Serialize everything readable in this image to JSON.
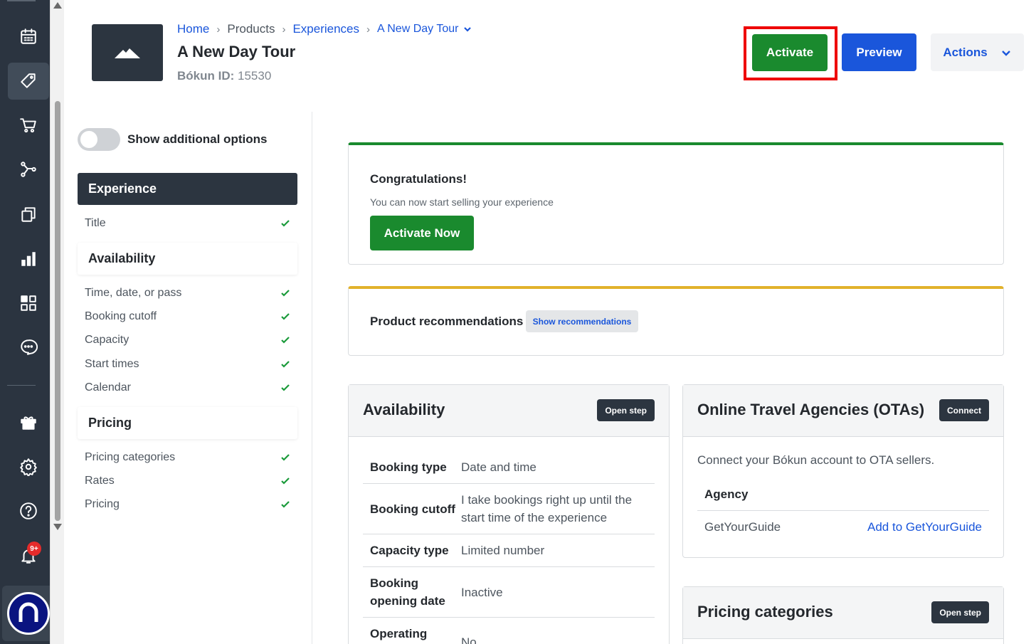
{
  "header": {
    "breadcrumb": {
      "home": "Home",
      "products": "Products",
      "experiences": "Experiences",
      "current": "A New Day Tour"
    },
    "title": "A New Day Tour",
    "bokun_id_label": "Bókun ID:",
    "bokun_id_value": "15530",
    "buttons": {
      "activate": "Activate",
      "preview": "Preview",
      "actions": "Actions"
    }
  },
  "rail": {
    "items": [
      "calendar-icon",
      "tag-icon",
      "cart-icon",
      "network-icon",
      "copy-icon",
      "bar-chart-icon",
      "widgets-icon",
      "chat-icon",
      "gift-icon",
      "gear-icon",
      "help-icon",
      "bell-icon"
    ],
    "notification_badge": "9+"
  },
  "sidenav": {
    "toggle_label": "Show additional options",
    "sections": [
      {
        "title": "Experience",
        "items": [
          "Title"
        ]
      },
      {
        "title": "Availability",
        "items": [
          "Time, date, or pass",
          "Booking cutoff",
          "Capacity",
          "Start times",
          "Calendar"
        ]
      },
      {
        "title": "Pricing",
        "items": [
          "Pricing categories",
          "Rates",
          "Pricing"
        ]
      }
    ]
  },
  "main": {
    "congrats": {
      "title": "Congratulations!",
      "subtitle": "You can now start selling your experience",
      "button": "Activate Now"
    },
    "recommendations": {
      "title": "Product recommendations",
      "button": "Show recommendations"
    },
    "availability": {
      "title": "Availability",
      "button": "Open step",
      "rows": [
        {
          "key": "Booking type",
          "value": "Date and time"
        },
        {
          "key": "Booking cutoff",
          "value": "I take bookings right up until the start time of the experience"
        },
        {
          "key": "Capacity type",
          "value": "Limited number"
        },
        {
          "key": "Booking opening date",
          "value": "Inactive"
        },
        {
          "key": "Operating",
          "value": "No"
        }
      ]
    },
    "ota": {
      "title": "Online Travel Agencies (OTAs)",
      "button": "Connect",
      "description": "Connect your Bókun account to OTA sellers.",
      "agency_header": "Agency",
      "agency_name": "GetYourGuide",
      "agency_link": "Add to GetYourGuide"
    },
    "pricing_categories": {
      "title": "Pricing categories",
      "button": "Open step"
    }
  },
  "colors": {
    "green": "#1a8a2e",
    "blue": "#1a56db",
    "dark": "#2c3540",
    "highlight": "#ee0000",
    "yellow": "#e2b22c"
  }
}
